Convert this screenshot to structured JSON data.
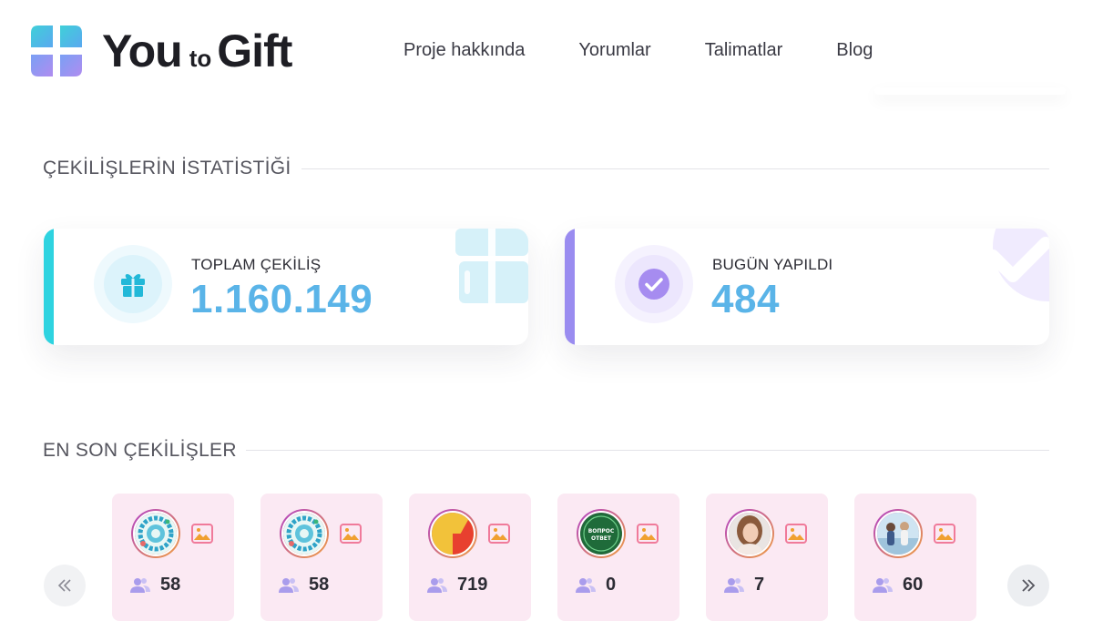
{
  "header": {
    "brand": {
      "you": "You",
      "to": "to",
      "gift": "Gift"
    },
    "nav": [
      "Proje hakkında",
      "Yorumlar",
      "Talimatlar",
      "Blog"
    ]
  },
  "stats_section": {
    "title": "ÇEKİLİŞLERİN İSTATİSTİĞİ",
    "cards": [
      {
        "label": "TOPLAM ÇEKİLİŞ",
        "value": "1.160.149",
        "icon": "gift-icon",
        "accent": "#2ed3e0"
      },
      {
        "label": "BUGÜN YAPILDI",
        "value": "484",
        "icon": "check-circle-icon",
        "accent": "#9a8cf0"
      }
    ]
  },
  "recent_section": {
    "title": "EN SON ÇEKİLİŞLER",
    "prev_icon": "chevron-double-left-icon",
    "next_icon": "chevron-double-right-icon",
    "giveaways": [
      {
        "participants": "58",
        "avatar": "blue-wreath-avatar"
      },
      {
        "participants": "58",
        "avatar": "blue-wreath-avatar"
      },
      {
        "participants": "719",
        "avatar": "yellow-red-circle-avatar"
      },
      {
        "participants": "0",
        "avatar": "green-badge-avatar"
      },
      {
        "participants": "7",
        "avatar": "woman-portrait-avatar"
      },
      {
        "participants": "60",
        "avatar": "group-photo-avatar"
      }
    ],
    "green_badge_text": [
      "ВОПРОС",
      "ОТВЕТ"
    ]
  },
  "colors": {
    "accent_blue": "#5ab4e8",
    "accent_cyan": "#2ed3e0",
    "accent_purple": "#9a8cf0",
    "card_pink": "#fbe9f3"
  }
}
